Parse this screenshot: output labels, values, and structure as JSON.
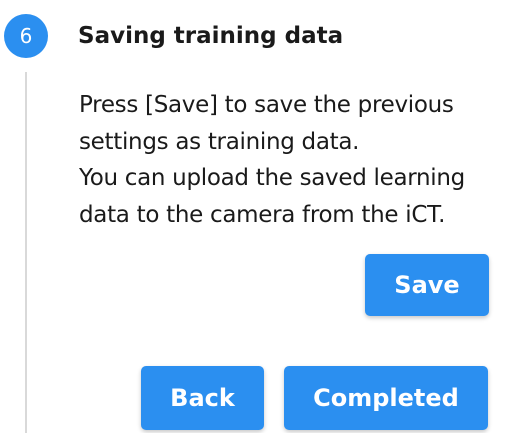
{
  "step": {
    "number": "6",
    "title": "Saving training data"
  },
  "description": {
    "lines": [
      "Press [Save] to save the previous",
      "settings as training data.",
      "You can upload the saved learning",
      "data to the camera from the iCT."
    ]
  },
  "buttons": {
    "save": "Save",
    "back": "Back",
    "completed": "Completed"
  },
  "colors": {
    "accent": "#2b8ff0",
    "line": "#d9d9d9"
  }
}
